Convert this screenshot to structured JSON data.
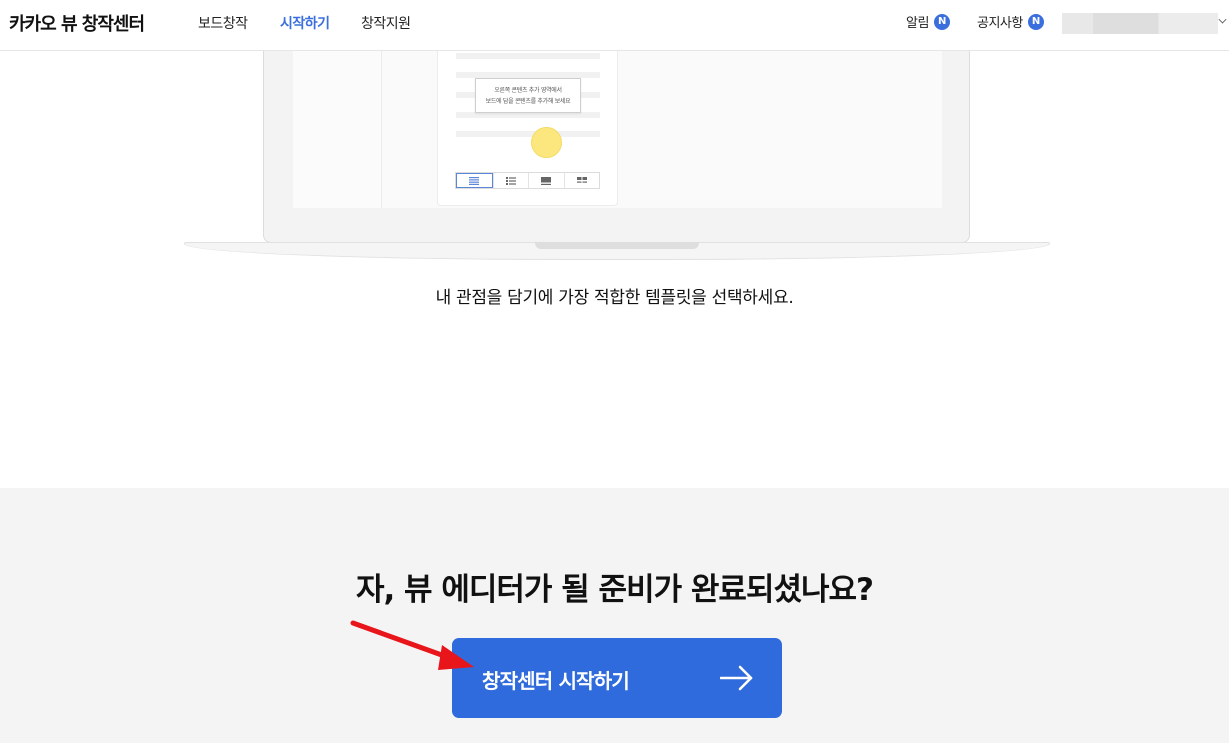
{
  "header": {
    "logo": "카카오 뷰 창작센터",
    "nav": [
      {
        "label": "보드창작",
        "active": false
      },
      {
        "label": "시작하기",
        "active": true
      },
      {
        "label": "창작지원",
        "active": false
      }
    ],
    "alerts_label": "알림",
    "alerts_badge": "N",
    "notice_label": "공지사항",
    "notice_badge": "N"
  },
  "illustration": {
    "tooltip_line1": "오른쪽 콘텐츠 추가 영역에서",
    "tooltip_line2": "보드에 담을 콘텐츠를 추가해 보세요",
    "highlight_color": "#fbe77d"
  },
  "caption": "내 관점을 담기에 가장 적합한 템플릿을 선택하세요.",
  "cta": {
    "title": "자, 뷰 에디터가 될 준비가 완료되셨나요?",
    "button_label": "창작센터 시작하기",
    "button_color": "#2f6bdc",
    "arrow_icon": "arrow-right-icon"
  },
  "annotation": {
    "pointer_color": "#e8151b"
  }
}
